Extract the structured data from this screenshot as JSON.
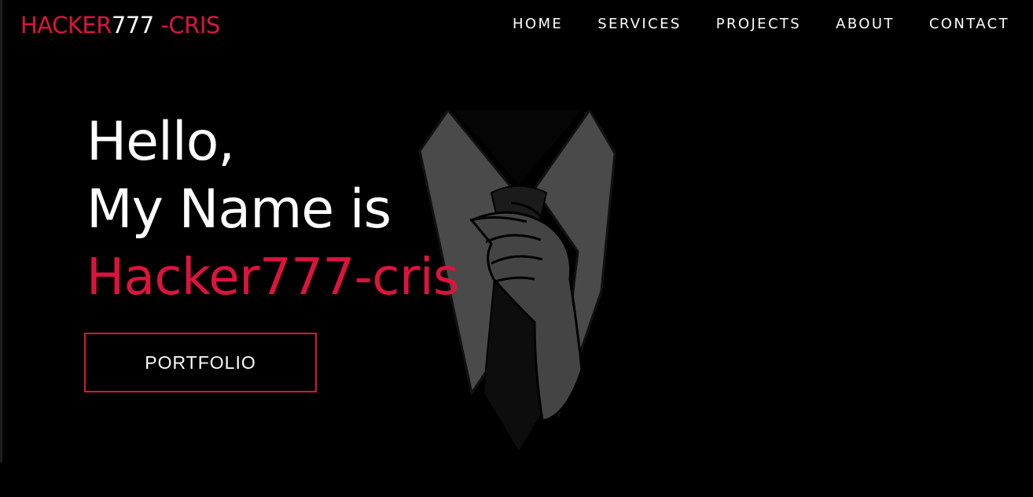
{
  "logo": {
    "part1": "HACKER",
    "part2": "777",
    "part3": " -CRIS",
    "accent_color": "#dc143c"
  },
  "nav": {
    "items": [
      "HOME",
      "SERVICES",
      "PROJECTS",
      "ABOUT",
      "CONTACT"
    ]
  },
  "hero": {
    "line1": "Hello,",
    "line2": "My Name is",
    "name": "Hacker777-cris",
    "button_label": "PORTFOLIO",
    "illustration": "suit-and-tie-icon"
  },
  "colors": {
    "background": "#000000",
    "accent": "#dc143c",
    "text": "#ffffff"
  }
}
